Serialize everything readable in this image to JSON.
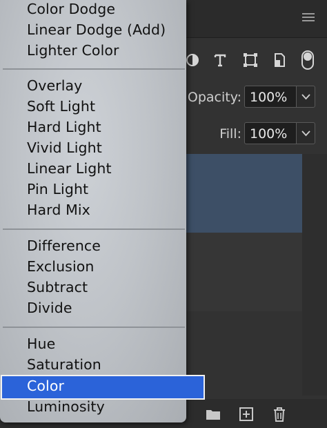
{
  "panel": {
    "opacity_label": "Opacity:",
    "opacity_value": "100%",
    "fill_label": "Fill:",
    "fill_value": "100%",
    "filter_icons": [
      "adjustment-filter-icon",
      "type-filter-icon",
      "shape-filter-icon",
      "smart-object-filter-icon",
      "filter-toggle-icon"
    ],
    "bottom_icons": [
      "new-group-folder-icon",
      "new-layer-icon",
      "delete-layer-icon"
    ]
  },
  "blend_menu": {
    "groups": [
      [
        "Color Dodge",
        "Linear Dodge (Add)",
        "Lighter Color"
      ],
      [
        "Overlay",
        "Soft Light",
        "Hard Light",
        "Vivid Light",
        "Linear Light",
        "Pin Light",
        "Hard Mix"
      ],
      [
        "Difference",
        "Exclusion",
        "Subtract",
        "Divide"
      ],
      [
        "Hue",
        "Saturation",
        "Color",
        "Luminosity"
      ]
    ],
    "selected": "Color",
    "highlight_color": "#2b63d9"
  }
}
